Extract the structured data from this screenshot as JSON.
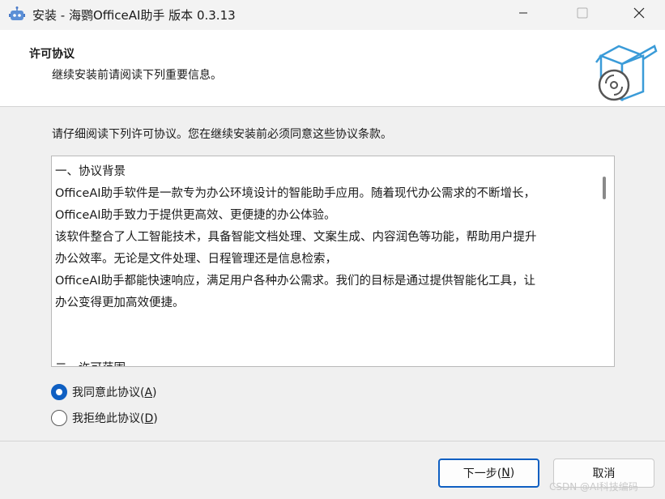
{
  "window": {
    "title": "安装 - 海鹦OfficeAI助手 版本 0.3.13"
  },
  "header": {
    "title": "许可协议",
    "subtitle": "继续安装前请阅读下列重要信息。"
  },
  "intro": "请仔细阅读下列许可协议。您在继续安装前必须同意这些协议条款。",
  "license": {
    "lines": [
      "一、协议背景",
      "OfficeAI助手软件是一款专为办公环境设计的智能助手应用。随着现代办公需求的不断增长，",
      "OfficeAI助手致力于提供更高效、更便捷的办公体验。",
      "该软件整合了人工智能技术，具备智能文档处理、文案生成、内容润色等功能，帮助用户提升",
      "办公效率。无论是文件处理、日程管理还是信息检索，",
      "OfficeAI助手都能快速响应，满足用户各种办公需求。我们的目标是通过提供智能化工具，让",
      "办公变得更加高效便捷。"
    ],
    "next_heading": "二、许可范围"
  },
  "options": {
    "accept": {
      "label": "我同意此协议(",
      "key": "A",
      "suffix": ")",
      "selected": true
    },
    "decline": {
      "label": "我拒绝此协议(",
      "key": "D",
      "suffix": ")",
      "selected": false
    }
  },
  "buttons": {
    "next": {
      "label": "下一步(",
      "key": "N",
      "suffix": ")"
    },
    "cancel": "取消"
  },
  "watermark": "CSDN @AI科技编码",
  "colors": {
    "accent": "#0f5fc2",
    "header_bg": "#ffffff",
    "body_bg": "#f0f0f0"
  },
  "icons": {
    "app": "robot-icon",
    "header": "software-box-cd-icon"
  }
}
